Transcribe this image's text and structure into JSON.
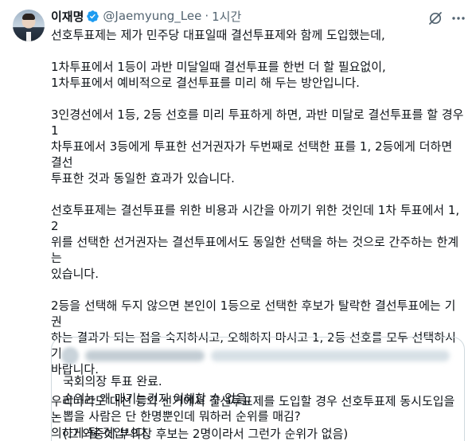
{
  "tweet": {
    "display_name": "이재명",
    "handle": "@Jaemyung_Lee",
    "separator": "·",
    "time": "1시간",
    "paragraphs": [
      "선호투표제는 제가 민주당 대표일때 결선투표제와 함께 도입했는데,",
      "1차투표에서 1등이 과반 미달일때 결선투표를 한번 더 할 필요없이,\n1차투표에서 예비적으로 결선투표를 미리 해 두는 방안입니다.",
      "3인경선에서 1등, 2등 선호를 미리 투표하게 하면, 과반 미달로 결선투표를 할 경우 1\n차투표에서 3등에게 투표한 선거권자가 두번째로 선택한 표를 1, 2등에게 더하면 결선\n투표한 것과 동일한 효과가 있습니다.",
      "선호투표제는 결선투표를 위한 비용과 시간을 아끼기 위한 것인데 1차 투표에서 1, 2\n위를 선택한 선거권자는 결선투표에서도 동일한 선택을 하는 것으로 간주하는 한계는\n있습니다.",
      "2등을 선택해 두지 않으면 본인이 1등으로 선택한 후보가 탈락한 결선투표에는 기권\n하는 결과가 되는 점을 숙지하시고, 오해하지 마시고 1, 2등 선호를 모두 선택하시기\n바랍니다.",
      "우리나라도 대선 등의 선거에서 결선투표제를 도입할 경우 선호투표제 동시도입을 논\n의하게 될 것입니다."
    ]
  },
  "quote": {
    "lines": [
      "국회의장 투표 완료.",
      "순위는 왜 매기는건지 이해할 수 없음.",
      "뽑을 사람은 단 한명뿐인데 뭐하러 순위를 매김?",
      "(그 와중에 부의장 후보는 2명이라서 그런가 순위가 없음)"
    ]
  },
  "colors": {
    "text": "#0f1419",
    "secondary": "#536471",
    "verified": "#1d9bf0",
    "border": "#cfd9de"
  },
  "icons": {
    "verified": "verified-badge-icon",
    "grok": "grok-icon",
    "more": "more-options-icon"
  }
}
